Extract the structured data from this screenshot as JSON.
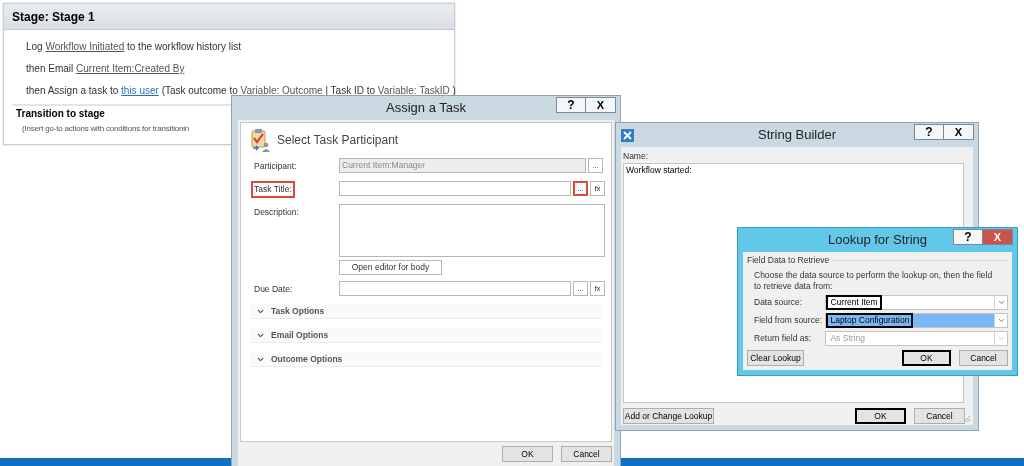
{
  "stage": {
    "title": "Stage: Stage 1",
    "actions": [
      {
        "parts": [
          {
            "kind": "text",
            "text": "Log "
          },
          {
            "kind": "token",
            "text": "Workflow Initiated"
          },
          {
            "kind": "text",
            "text": " to the workflow history list"
          }
        ]
      },
      {
        "parts": [
          {
            "kind": "text",
            "text": "then Email "
          },
          {
            "kind": "token",
            "text": "Current Item:Created By"
          }
        ]
      },
      {
        "parts": [
          {
            "kind": "text",
            "text": "then Assign a task to "
          },
          {
            "kind": "link",
            "text": "this user"
          },
          {
            "kind": "text",
            "text": " (Task outcome to "
          },
          {
            "kind": "token",
            "text": "Variable: Outcome"
          },
          {
            "kind": "text",
            "text": " | Task ID to "
          },
          {
            "kind": "token",
            "text": "Variable: TaskID"
          },
          {
            "kind": "text",
            "text": " )"
          }
        ]
      }
    ],
    "transition": {
      "title": "Transition to stage",
      "hint": "(Insert go-to actions with conditions for transitionin"
    }
  },
  "assign_dialog": {
    "title": "Assign a Task",
    "help": "?",
    "close": "X",
    "heading": "Select Task Participant",
    "fields": [
      {
        "kind": "line",
        "label": "Participant:",
        "value": "Current Item:Manager",
        "disabled": true,
        "label_highlighted": false,
        "buttons": [
          {
            "text": "...",
            "highlighted": false
          }
        ]
      },
      {
        "kind": "line",
        "label": "Task Title:",
        "disabled": false,
        "label_highlighted": true,
        "buttons": [
          {
            "text": "...",
            "highlighted": true
          },
          {
            "text": "fx",
            "highlighted": false
          }
        ]
      },
      {
        "kind": "multiline",
        "label": "Description:",
        "disabled": false,
        "label_highlighted": false,
        "buttons": [
          {
            "text": "Open editor for body",
            "highlighted": false
          }
        ]
      },
      {
        "kind": "line",
        "label": "Due Date:",
        "disabled": false,
        "label_highlighted": false,
        "buttons": [
          {
            "text": "...",
            "highlighted": false
          },
          {
            "text": "fx",
            "highlighted": false
          }
        ]
      }
    ],
    "sections": [
      {
        "title": "Task Options",
        "expanded": false
      },
      {
        "title": "Email Options",
        "expanded": false
      },
      {
        "title": "Outcome Options",
        "expanded": false
      }
    ],
    "buttons": [
      {
        "text": "OK",
        "highlighted": false
      },
      {
        "text": "Cancel",
        "highlighted": false
      }
    ]
  },
  "string_builder": {
    "title": "String Builder",
    "help": "?",
    "close": "X",
    "name_label": "Name:",
    "value": "Workflow started:",
    "buttons": [
      {
        "text": "Add or Change Lookup",
        "highlighted": false
      },
      {
        "text": "OK",
        "highlighted": true
      },
      {
        "text": "Cancel",
        "highlighted": false
      }
    ]
  },
  "lookup_dialog": {
    "title": "Lookup for String",
    "help": "?",
    "close": "X",
    "group": "Field Data to Retrieve",
    "description": "Choose the data source to perform the lookup on, then the field to retrieve data from:",
    "rows": [
      {
        "label": "Data source:",
        "value": "Current Item",
        "highlighted": true,
        "selected": false,
        "disabled": false
      },
      {
        "label": "Field from source:",
        "value": "Laptop Configuration",
        "highlighted": true,
        "selected": true,
        "disabled": false
      },
      {
        "label": "Return field as:",
        "value": "As String",
        "highlighted": false,
        "selected": false,
        "disabled": true
      }
    ],
    "buttons": [
      {
        "text": "Clear Lookup",
        "highlighted": false
      },
      {
        "text": "OK",
        "highlighted": true
      },
      {
        "text": "Cancel",
        "highlighted": false
      }
    ]
  }
}
